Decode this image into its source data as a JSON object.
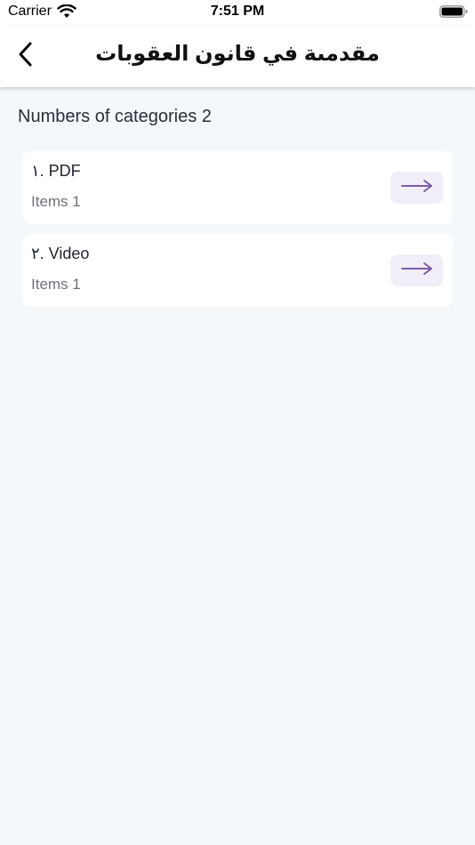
{
  "status_bar": {
    "carrier": "Carrier",
    "time": "7:51 PM",
    "wifi_icon": "wifi-icon",
    "battery_icon": "battery-icon"
  },
  "nav": {
    "title": "مقدمىة في قانون العقوبات",
    "back_icon": "chevron-left-icon"
  },
  "categories": {
    "count_label": "Numbers of categories 2",
    "items": [
      {
        "title": "١. PDF",
        "subtitle": "Items 1",
        "icon": "arrow-right-icon"
      },
      {
        "title": "٢. Video",
        "subtitle": "Items 1",
        "icon": "arrow-right-icon"
      }
    ]
  },
  "colors": {
    "background": "#f5f8fb",
    "card": "#ffffff",
    "accent": "#7a5ca8",
    "arrow_button_bg": "#f2eef7"
  }
}
